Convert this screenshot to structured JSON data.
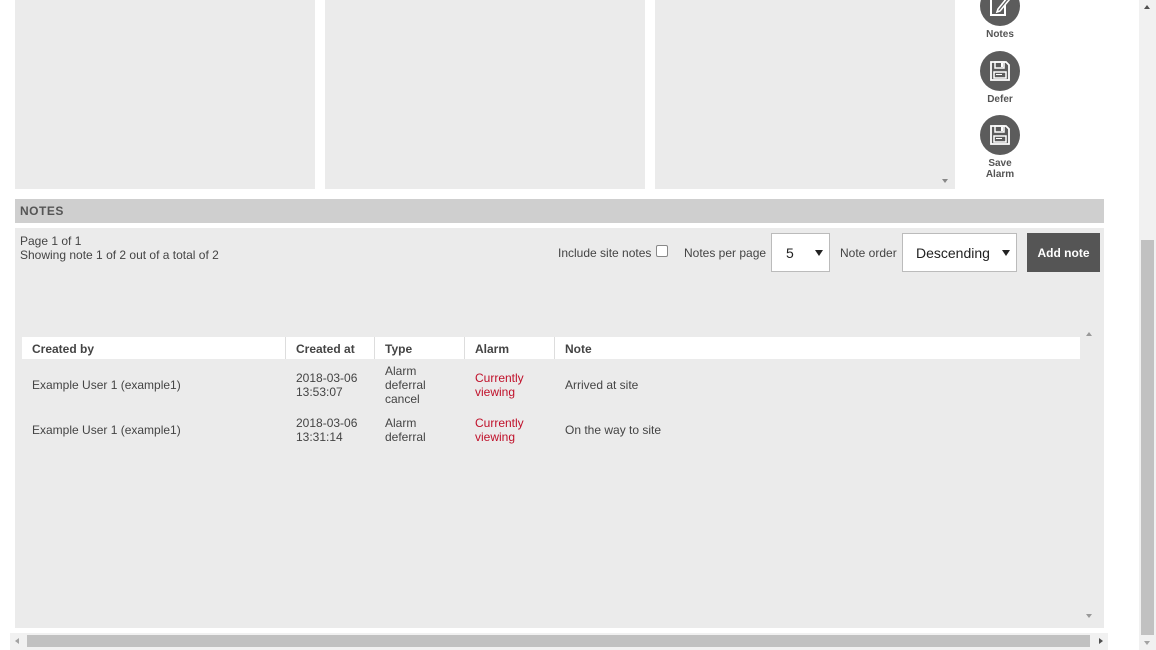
{
  "actions": {
    "notes_label": "Notes",
    "defer_label": "Defer",
    "save_label_line1": "Save",
    "save_label_line2": "Alarm"
  },
  "notes": {
    "header": "NOTES",
    "page_text": "Page 1 of 1",
    "showing_text": "Showing note 1 of 2 out of a total of 2",
    "include_site_notes_label": "Include site notes",
    "include_site_notes_checked": false,
    "notes_per_page_label": "Notes per page",
    "notes_per_page_value": "5",
    "note_order_label": "Note order",
    "note_order_value": "Descending",
    "add_note_label": "Add note"
  },
  "table": {
    "columns": [
      "Created by",
      "Created at",
      "Type",
      "Alarm",
      "Note"
    ],
    "rows": [
      {
        "created_by": "Example User 1 (example1)",
        "created_date": "2018-03-06",
        "created_time": "13:53:07",
        "type_lines": [
          "Alarm",
          "deferral",
          "cancel"
        ],
        "alarm_lines": [
          "Currently",
          "viewing"
        ],
        "note": "Arrived at site"
      },
      {
        "created_by": "Example User 1 (example1)",
        "created_date": "2018-03-06",
        "created_time": "13:31:14",
        "type_lines": [
          "Alarm",
          "deferral"
        ],
        "alarm_lines": [
          "Currently",
          "viewing"
        ],
        "note": "On the way to site"
      }
    ]
  },
  "colors": {
    "alarm_link": "#c0102a",
    "button_dark": "#555555",
    "panel_bg": "#ebebeb",
    "header_bg": "#cfcfcf"
  }
}
